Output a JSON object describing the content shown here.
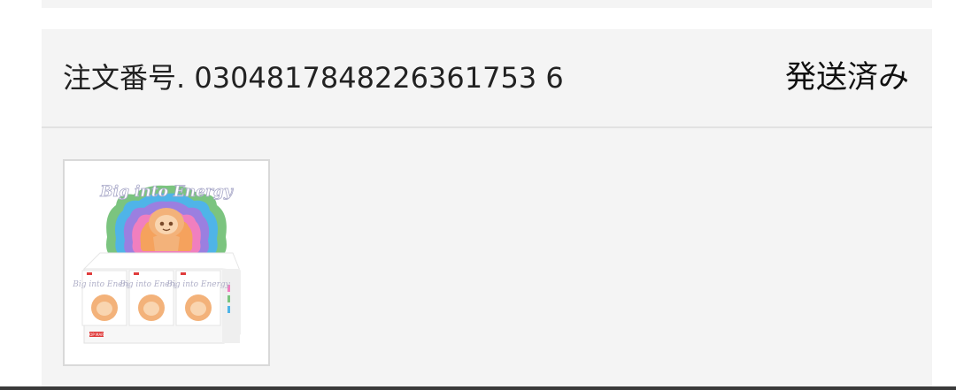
{
  "order": {
    "number_label": "注文番号. 0304817848226361753 6",
    "status": "発送済み"
  },
  "product": {
    "image_icon": "product-box-display-image",
    "logo_text": "Big into Energy",
    "box_logo_text": "Big into Energy",
    "brand_tag": "POP MART",
    "colors": {
      "rainbow": [
        "#7bc47f",
        "#4fb4e8",
        "#9b7fe0",
        "#f07fbf",
        "#f5a25d"
      ],
      "figure": "#f3b27a"
    }
  }
}
